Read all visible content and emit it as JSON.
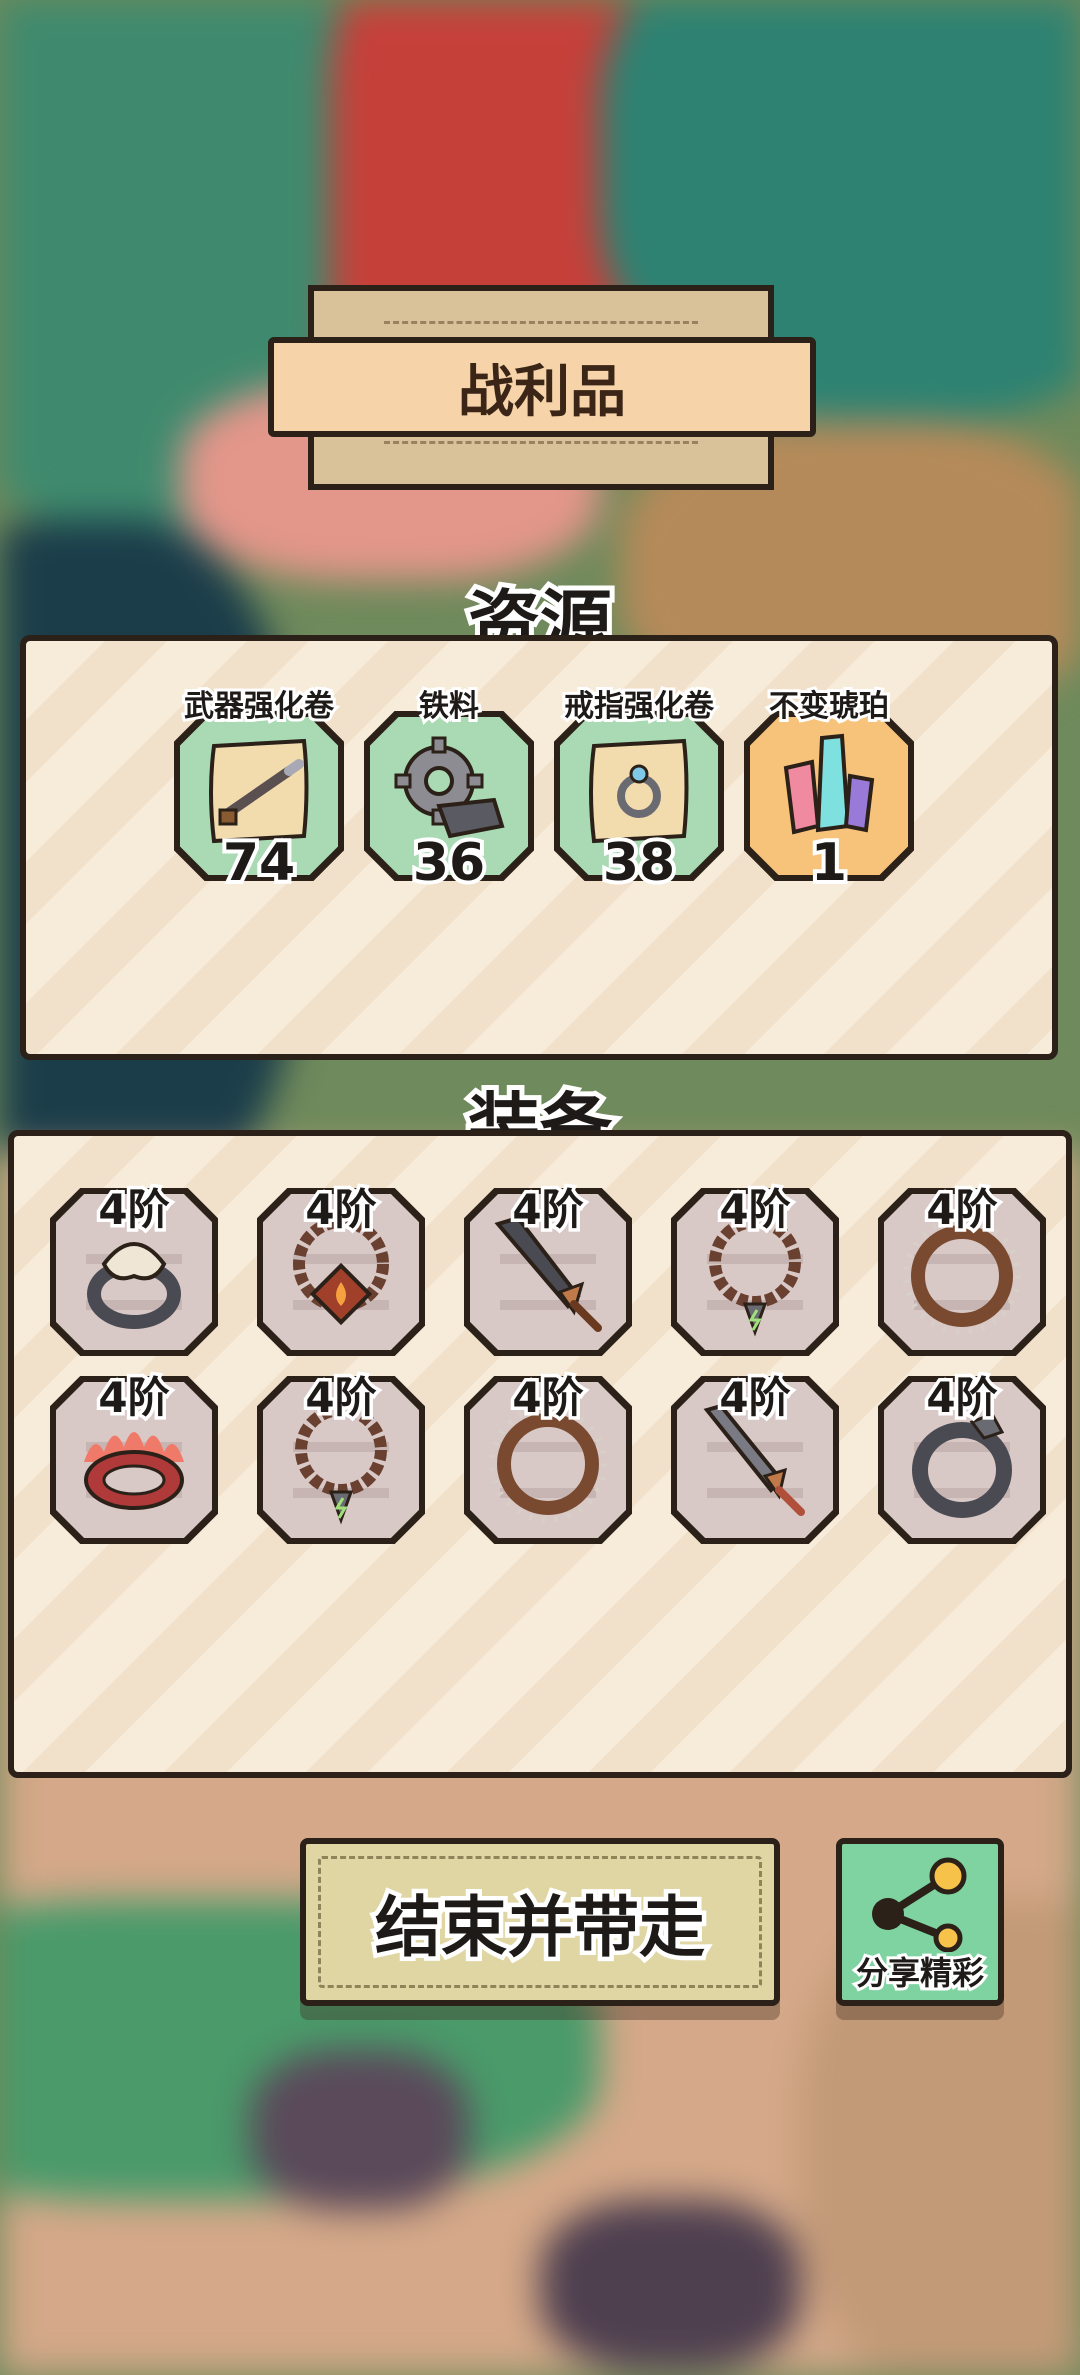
{
  "title": "战利品",
  "resources": {
    "label": "资源",
    "items": [
      {
        "name": "武器强化卷",
        "count": "74",
        "icon": "weapon-scroll-icon",
        "rarity": "green"
      },
      {
        "name": "铁料",
        "count": "36",
        "icon": "iron-gear-icon",
        "rarity": "green"
      },
      {
        "name": "戒指强化卷",
        "count": "38",
        "icon": "ring-scroll-icon",
        "rarity": "green"
      },
      {
        "name": "不变琥珀",
        "count": "1",
        "icon": "crystal-amber-icon",
        "rarity": "orange"
      }
    ]
  },
  "equipment": {
    "label": "装备",
    "items": [
      {
        "tier": "4阶",
        "icon": "bone-ring-icon"
      },
      {
        "tier": "4阶",
        "icon": "fire-necklace-icon"
      },
      {
        "tier": "4阶",
        "icon": "broadsword-icon"
      },
      {
        "tier": "4阶",
        "icon": "bead-necklace-icon"
      },
      {
        "tier": "4阶",
        "icon": "spiked-ring-icon"
      },
      {
        "tier": "4阶",
        "icon": "flame-ring-icon"
      },
      {
        "tier": "4阶",
        "icon": "bead-necklace-icon"
      },
      {
        "tier": "4阶",
        "icon": "spiked-ring-icon"
      },
      {
        "tier": "4阶",
        "icon": "short-sword-icon"
      },
      {
        "tier": "4阶",
        "icon": "iron-ring-icon"
      }
    ]
  },
  "buttons": {
    "end_label": "结束并带走",
    "share_label": "分享精彩"
  },
  "colors": {
    "rare_green": "#a9dab3",
    "epic_orange": "#f7c27a",
    "share_green": "#7fd3a1",
    "outline": "#2b2118"
  }
}
